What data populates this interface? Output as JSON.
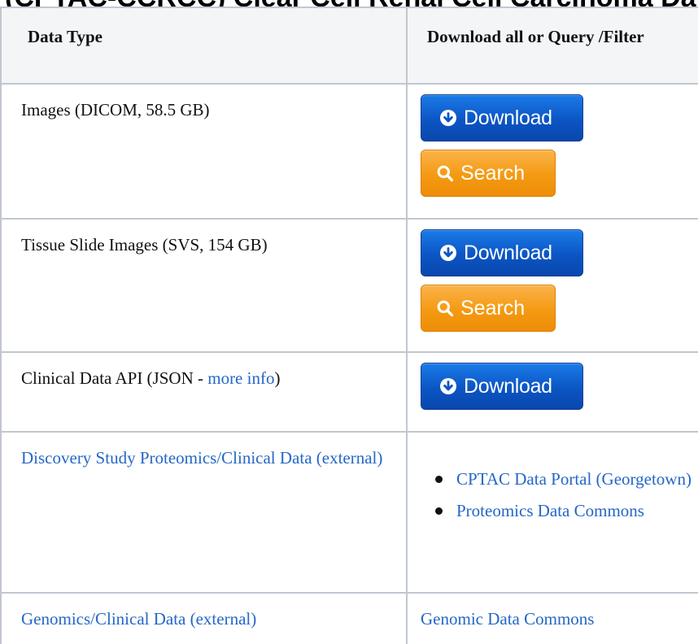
{
  "heading_partial": "(CPTAC-CCRCC) Clear Cell Renal Cell Carcinoma Data Access",
  "table": {
    "headers": [
      "Data Type",
      "Download all or Query /Filter"
    ],
    "rows": [
      {
        "label": "Images (DICOM, 58.5 GB)",
        "download_label": "Download",
        "search_label": "Search"
      },
      {
        "label": "Tissue Slide Images (SVS, 154 GB)",
        "download_label": "Download",
        "search_label": "Search"
      },
      {
        "label_prefix": "Clinical Data API (JSON - ",
        "label_link": "more info",
        "label_suffix": ")",
        "download_label": "Download"
      },
      {
        "label": "Discovery Study Proteomics/Clinical Data (external)",
        "links": [
          "CPTAC Data Portal (Georgetown)",
          "Proteomics Data Commons"
        ]
      },
      {
        "label": "Genomics/Clinical Data (external)",
        "link": "Genomic Data Commons"
      }
    ]
  },
  "icons": {
    "download": "circle-down-arrow-icon",
    "search": "magnifier-icon"
  },
  "colors": {
    "download_button": "#0b55c4",
    "search_button": "#f49a12",
    "link": "#2567c6",
    "header_background": "#f4f5f7",
    "border": "#c1c7d0"
  }
}
